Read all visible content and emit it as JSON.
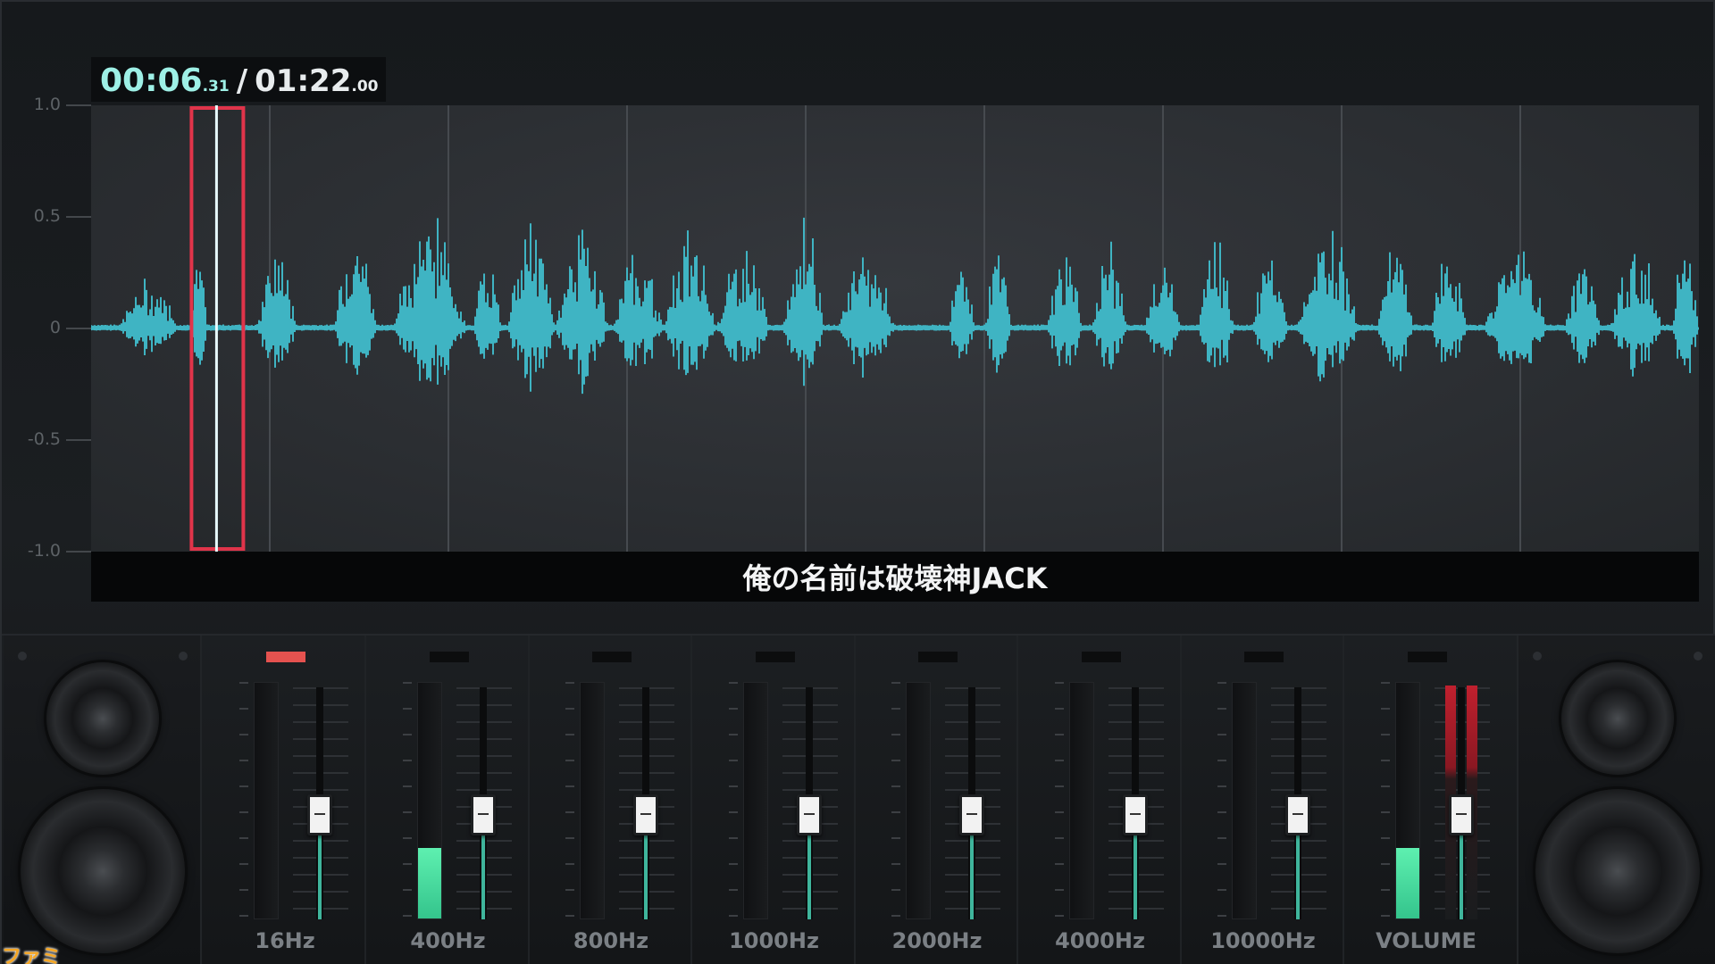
{
  "timecode": {
    "current_main": "00:06",
    "current_frac": ".31",
    "separator": "/",
    "total_main": "01:22",
    "total_frac": ".00"
  },
  "waveform": {
    "y_axis_labels": [
      "1.0",
      "0.5",
      "0",
      "-0.5",
      "-1.0"
    ],
    "y_range": [
      -1.0,
      1.0
    ],
    "vertical_gridlines": 9,
    "playhead_fraction": 0.078,
    "wave_color": "#3fb4c3",
    "selection_color": "#e0344a"
  },
  "subtitle": "俺の名前は破壊神JACK",
  "mixer": {
    "accent_color": "#3fb59c",
    "indicator_active_color": "#e5524f",
    "channels": [
      {
        "label": "16Hz",
        "active": true,
        "meter_level": 0.0,
        "fader_level": 0.45
      },
      {
        "label": "400Hz",
        "active": false,
        "meter_level": 0.3,
        "fader_level": 0.45
      },
      {
        "label": "800Hz",
        "active": false,
        "meter_level": 0.0,
        "fader_level": 0.45
      },
      {
        "label": "1000Hz",
        "active": false,
        "meter_level": 0.0,
        "fader_level": 0.45
      },
      {
        "label": "2000Hz",
        "active": false,
        "meter_level": 0.0,
        "fader_level": 0.45
      },
      {
        "label": "4000Hz",
        "active": false,
        "meter_level": 0.0,
        "fader_level": 0.45
      },
      {
        "label": "10000Hz",
        "active": false,
        "meter_level": 0.0,
        "fader_level": 0.45
      }
    ],
    "volume": {
      "label": "VOLUME",
      "meter_level": 0.3,
      "fader_level": 0.45
    }
  },
  "watermark": "ファミ通.com"
}
